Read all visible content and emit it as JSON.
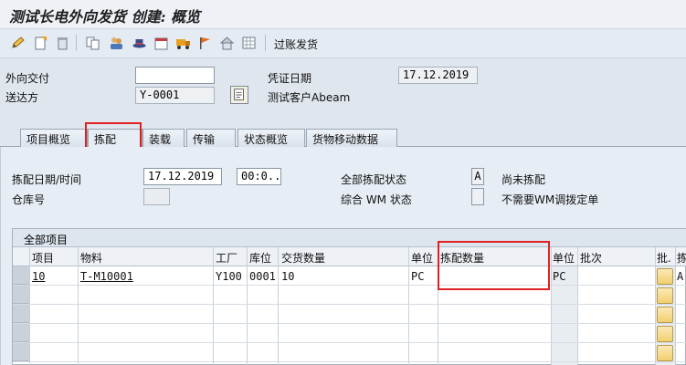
{
  "window": {
    "title": "测试长电外向发货 创建: 概览"
  },
  "toolbar": {
    "icons": [
      "pencil-icon",
      "new-doc-icon",
      "trash-icon",
      "copy-icon",
      "people-icon",
      "hat-icon",
      "calendar-icon",
      "truck-icon",
      "flag-icon",
      "home-icon",
      "grid-icon"
    ],
    "post_label": "过账发货"
  },
  "header": {
    "outbound_delivery_label": "外向交付",
    "outbound_delivery_value": "",
    "ship_to_label": "送达方",
    "ship_to_value": "Y-0001",
    "doc_date_label": "凭证日期",
    "doc_date_value": "17.12.2019",
    "customer_name": "测试客户Abeam"
  },
  "tabs": [
    {
      "label": "项目概览"
    },
    {
      "label": "拣配"
    },
    {
      "label": "装载"
    },
    {
      "label": "传输"
    },
    {
      "label": "状态概览"
    },
    {
      "label": "货物移动数据"
    }
  ],
  "picking": {
    "date_time_label": "拣配日期/时间",
    "date_value": "17.12.2019",
    "time_value": "00:0...",
    "warehouse_label": "仓库号",
    "warehouse_value": "",
    "overall_status_label": "全部拣配状态",
    "overall_status_value": "A",
    "overall_status_text": "尚未拣配",
    "wm_status_label": "综合 WM 状态",
    "wm_status_value": "",
    "wm_status_text": "不需要WM调拨定单"
  },
  "table": {
    "title": "全部项目",
    "columns": [
      "项目",
      "物料",
      "工厂",
      "库位",
      "交货数量",
      "单位",
      "拣配数量",
      "单位",
      "批次",
      "批.",
      "拣"
    ],
    "rows": [
      {
        "item": "10",
        "material": "T-M10001",
        "plant": "Y100",
        "sloc": "0001",
        "qty": "10",
        "unit": "PC",
        "pick_qty": "",
        "unit2": "PC",
        "batch": "",
        "batch_ind": "A"
      }
    ]
  },
  "colors": {
    "highlight": "#e02020",
    "panel": "#e6edf4"
  }
}
